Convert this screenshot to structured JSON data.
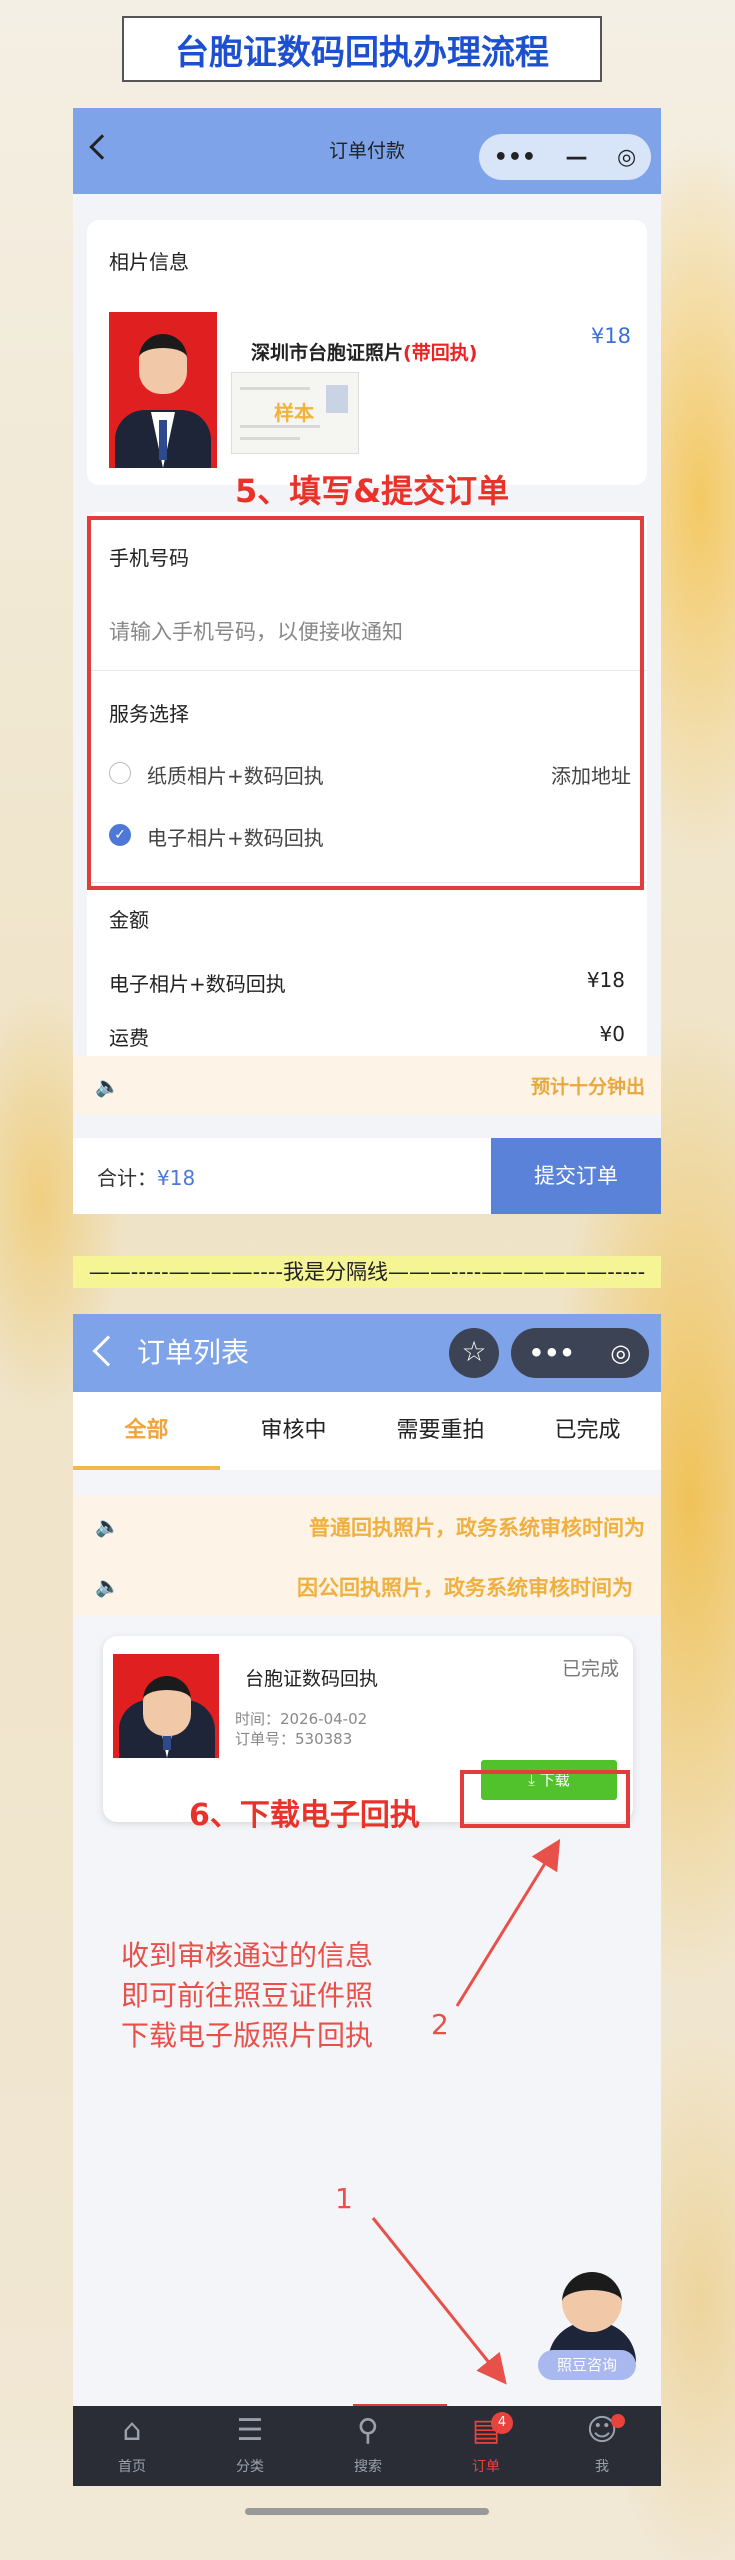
{
  "banner_title": "台胞证数码回执办理流程",
  "screen1": {
    "header": {
      "title": "订单付款",
      "more": "•••",
      "minimize": "—",
      "close": "◎"
    },
    "photo_section": {
      "label": "相片信息",
      "product_name": "深圳市台胞证照片",
      "product_tag": "(带回执)",
      "price": "¥18",
      "sample_stamp": "样本"
    },
    "step_title": "5、填写&提交订单",
    "phone": {
      "label": "手机号码",
      "placeholder": "请输入手机号码，以便接收通知"
    },
    "service": {
      "label": "服务选择",
      "option1": "纸质相片+数码回执",
      "option1_action": "添加地址",
      "option2": "电子相片+数码回执",
      "checkmark": "✓"
    },
    "amount": {
      "label": "金额",
      "item_name": "电子相片+数码回执",
      "item_price": "¥18",
      "shipping_name": "运费",
      "shipping_price": "¥0"
    },
    "notice": {
      "icon": "speaker-icon",
      "text": "预计十分钟出",
      "glyph": "🔈"
    },
    "footer": {
      "total_label": "合计：",
      "total_value": "¥18",
      "submit": "提交订单"
    }
  },
  "separator": "——-----————----我是分隔线———----——————-----",
  "screen2": {
    "header": {
      "title": "订单列表",
      "star": "☆",
      "more": "•••",
      "close": "◎"
    },
    "tabs": [
      "全部",
      "审核中",
      "需要重拍",
      "已完成"
    ],
    "notices": [
      {
        "text": "普通回执照片，政务系统审核时间为",
        "glyph": "🔈"
      },
      {
        "text": "因公回执照片，政务系统审核时间为",
        "glyph": "🔈"
      }
    ],
    "order": {
      "title": "台胞证数码回执",
      "time": "时间：2026-04-02",
      "order_no": "订单号：530383",
      "status": "已完成",
      "download": "⤓ 下载"
    },
    "step_title": "6、下载电子回执",
    "annotation": [
      "收到审核通过的信息",
      "即可前往照豆证件照",
      "下载电子版照片回执"
    ],
    "marker_2": "2",
    "marker_1": "1",
    "consult": "照豆咨询",
    "nav": [
      {
        "label": "首页",
        "glyph": "⌂"
      },
      {
        "label": "分类",
        "glyph": "☰"
      },
      {
        "label": "搜索",
        "glyph": "⚲"
      },
      {
        "label": "订单",
        "glyph": "▤",
        "badge": "4"
      },
      {
        "label": "我",
        "glyph": "☺"
      }
    ]
  },
  "colors": {
    "accent_blue": "#7ea3e8",
    "highlight_red": "#e33c3c",
    "download_green": "#52c22c",
    "tab_orange": "#f0a43c"
  }
}
